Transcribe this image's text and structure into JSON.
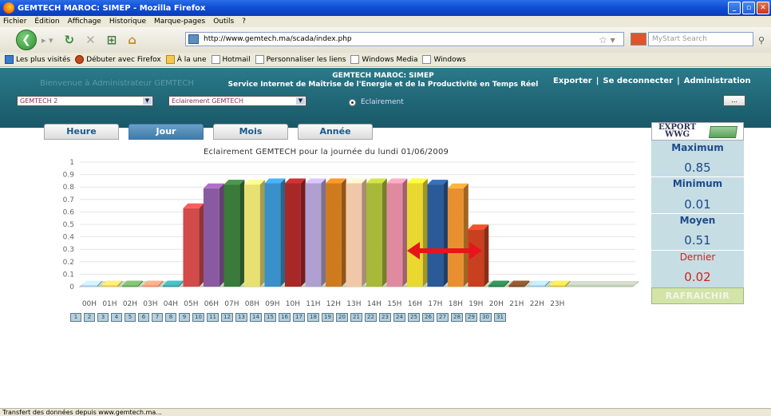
{
  "window": {
    "title": "GEMTECH MAROC: SIMEP - Mozilla Firefox"
  },
  "menubar": [
    "Fichier",
    "Édition",
    "Affichage",
    "Historique",
    "Marque-pages",
    "Outils",
    "?"
  ],
  "navbar": {
    "url": "http://www.gemtech.ma/scada/index.php",
    "search_placeholder": "MyStart Search"
  },
  "bookmarks": [
    "Les plus visités",
    "Débuter avec Firefox",
    "À la une",
    "Hotmail",
    "Personnaliser les liens",
    "Windows Media",
    "Windows"
  ],
  "header": {
    "ghost_text": "Bienvenue à Administrateur GEMTECH",
    "title_line1": "GEMTECH MAROC: SIMEP",
    "title_line2": "Service Internet de Maîtrise de l'Energie et de la Productivité en Temps Réel",
    "links": [
      "Exporter",
      "Se deconnecter",
      "Administration"
    ],
    "select_site": "GEMTECH 2",
    "select_type": "Eclairement GEMTECH",
    "radio_label": "Eclairement",
    "more_button": "..."
  },
  "tabs": [
    "Heure",
    "Jour",
    "Mois",
    "Année"
  ],
  "active_tab": "Jour",
  "stats": {
    "export_label_1": "EXPORT",
    "export_label_2": "WWG",
    "maximum_label": "Maximum",
    "maximum_value": "0.85",
    "minimum_label": "Minimum",
    "minimum_value": "0.01",
    "moyen_label": "Moyen",
    "moyen_value": "0.51",
    "dernier_label": "Dernier",
    "dernier_value": "0.02",
    "refresh_label": "RAFRAICHIR"
  },
  "pager": [
    "1",
    "2",
    "3",
    "4",
    "5",
    "6",
    "7",
    "8",
    "9",
    "10",
    "11",
    "12",
    "13",
    "14",
    "15",
    "16",
    "17",
    "18",
    "19",
    "20",
    "21",
    "22",
    "23",
    "24",
    "25",
    "26",
    "27",
    "28",
    "29",
    "30",
    "31"
  ],
  "status": "Transfert des données depuis www.gemtech.ma...",
  "colors": {
    "header_bg": "#1f6575",
    "accent_blue": "#1d4a8a",
    "stat_panel_bg": "#c6dde4",
    "dernier_red": "#d22020",
    "arrow_red": "#e8141c"
  },
  "chart_data": {
    "type": "bar",
    "title": "Eclairement GEMTECH pour la journée du lundi 01/06/2009",
    "categories": [
      "00H",
      "01H",
      "02H",
      "03H",
      "04H",
      "05H",
      "06H",
      "07H",
      "08H",
      "09H",
      "10H",
      "11H",
      "12H",
      "13H",
      "14H",
      "15H",
      "16H",
      "17H",
      "18H",
      "19H",
      "20H",
      "21H",
      "22H",
      "23H"
    ],
    "values": [
      0.01,
      0.01,
      0.01,
      0.01,
      0.01,
      0.63,
      0.79,
      0.82,
      0.82,
      0.83,
      0.83,
      0.83,
      0.83,
      0.83,
      0.83,
      0.83,
      0.83,
      0.82,
      0.79,
      0.46,
      0.01,
      0.01,
      0.01,
      0.01
    ],
    "bar_colors": [
      "#a8c4e0",
      "#e8c060",
      "#6aa060",
      "#e89070",
      "#3a9aa0",
      "#d24a4a",
      "#8a5aa0",
      "#3a7a3a",
      "#e8e070",
      "#3a90c8",
      "#a82828",
      "#b0a0d0",
      "#d07a20",
      "#f0c8a8",
      "#a8b838",
      "#e08aa0",
      "#e8d830",
      "#2a5a98",
      "#e89030",
      "#c84020",
      "#2a7a4a",
      "#7a4a2a",
      "#a0c0e0",
      "#d8c048"
    ],
    "yticks": [
      "0",
      "0.1",
      "0.2",
      "0.3",
      "0.4",
      "0.5",
      "0.6",
      "0.7",
      "0.8",
      "0.9",
      "1"
    ],
    "ylim": [
      0,
      1
    ],
    "grid": true,
    "annotation": "red double arrow between 14H and 17H"
  }
}
